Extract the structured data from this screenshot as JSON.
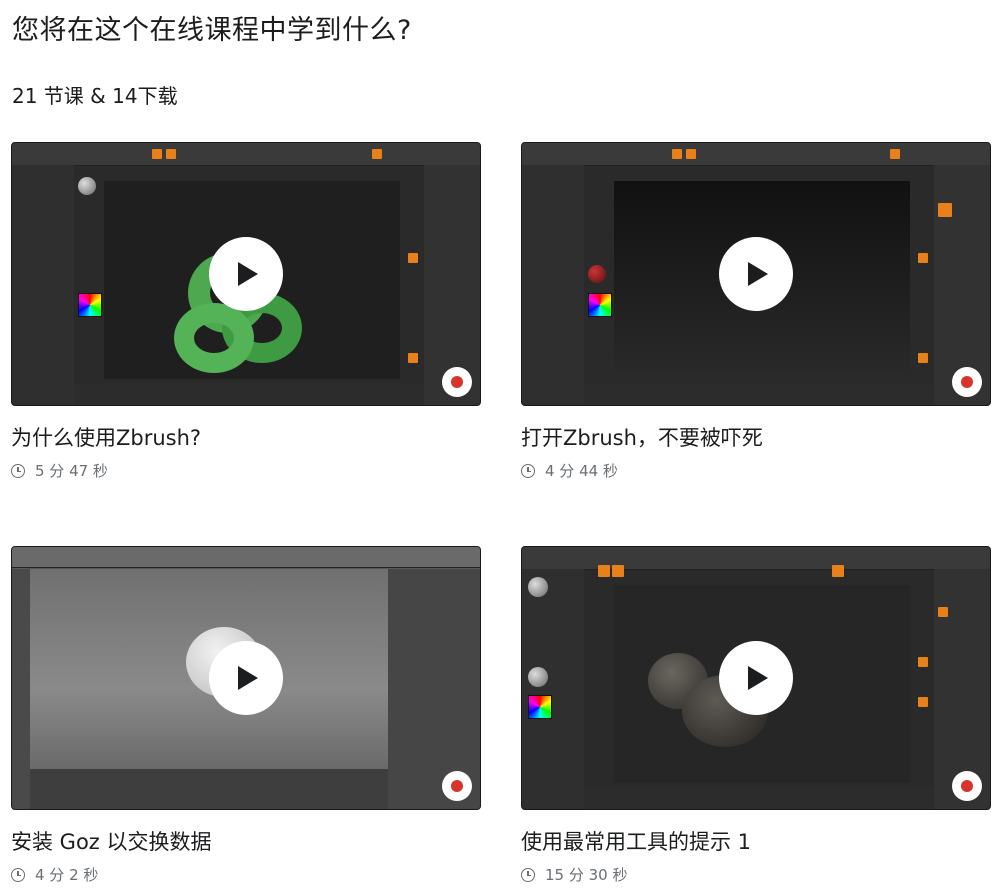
{
  "section": {
    "heading": "您将在这个在线课程中学到什么?",
    "summary": "21 节课 & 14下载"
  },
  "lessons": [
    {
      "title": "为什么使用Zbrush?",
      "duration": "5 分 47 秒"
    },
    {
      "title": "打开Zbrush，不要被吓死",
      "duration": "4 分 44 秒"
    },
    {
      "title": "安装 Goz 以交换数据",
      "duration": "4 分 2 秒"
    },
    {
      "title": "使用最常用工具的提示 1",
      "duration": "15 分 30 秒"
    }
  ],
  "icons": {
    "play": "play-icon",
    "clock": "clock-icon",
    "badge": "channel-logo-icon"
  },
  "colors": {
    "accent_orange": "#e8811a",
    "text": "#1c1d1f",
    "muted": "#6a6f73",
    "logo_red": "#d9342b"
  }
}
